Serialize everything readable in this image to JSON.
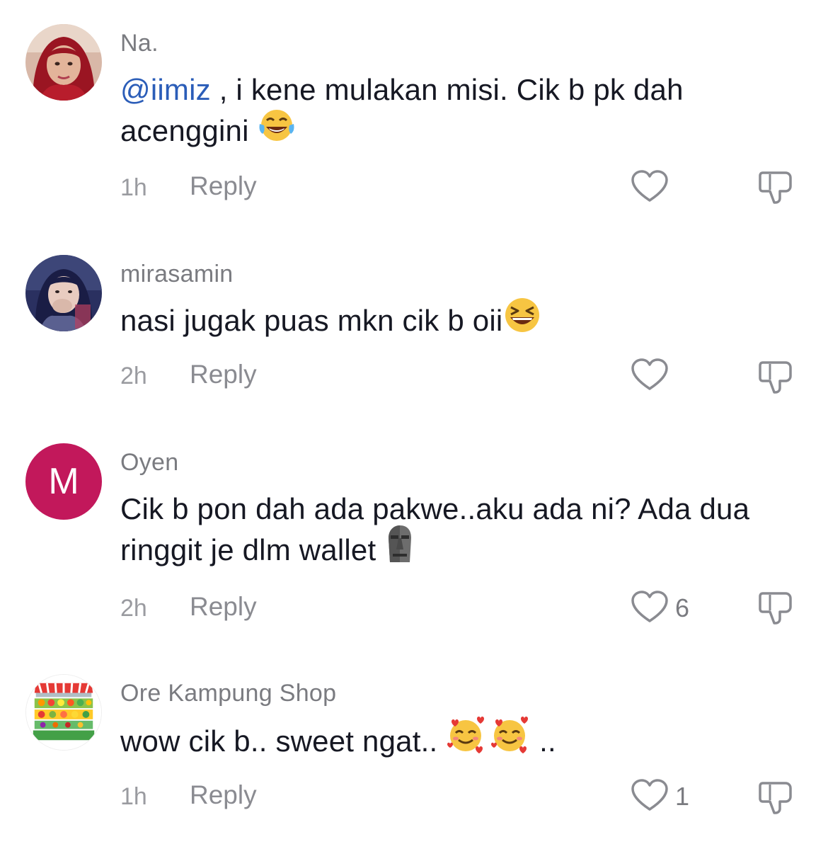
{
  "comments": [
    {
      "username": "Na.",
      "mention": "@iimiz",
      "text": " , i kene mulakan misi. Cik b pk dah acenggini ",
      "time": "1h",
      "reply_label": "Reply",
      "like_count": "",
      "emoji": "tears-of-joy-emoji",
      "avatar": "profile-photo"
    },
    {
      "username": "mirasamin",
      "text": "nasi jugak puas mkn cik b oii",
      "time": "2h",
      "reply_label": "Reply",
      "like_count": "",
      "emoji": "grinning-squinting-emoji",
      "avatar": "profile-photo"
    },
    {
      "username": "Oyen",
      "text": "Cik b pon dah ada pakwe..aku ada ni? Ada dua ringgit je dlm wallet ",
      "time": "2h",
      "reply_label": "Reply",
      "like_count": "6",
      "emoji": "moai-emoji",
      "avatar_letter": "M",
      "avatar_color": "#c2185b"
    },
    {
      "username": "Ore Kampung Shop",
      "text": "wow cik b.. sweet ngat.. ",
      "text_suffix": " ..",
      "time": "1h",
      "reply_label": "Reply",
      "like_count": "1",
      "emoji": "smiling-face-with-hearts-emoji",
      "avatar": "shop-logo"
    }
  ],
  "colors": {
    "mention": "#2b5db8",
    "username": "#7a7b80",
    "text": "#161823",
    "meta": "#8a8b91"
  }
}
